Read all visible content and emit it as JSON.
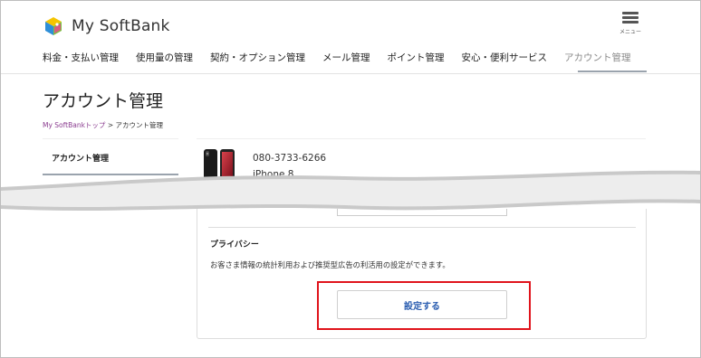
{
  "header": {
    "brand": "My SoftBank",
    "menu_label": "メニュー"
  },
  "nav": {
    "items": [
      {
        "label": "料金・支払い管理"
      },
      {
        "label": "使用量の管理"
      },
      {
        "label": "契約・オプション管理"
      },
      {
        "label": "メール管理"
      },
      {
        "label": "ポイント管理"
      },
      {
        "label": "安心・便利サービス"
      },
      {
        "label": "アカウント管理",
        "active": true
      }
    ]
  },
  "page": {
    "title": "アカウント管理",
    "breadcrumb": {
      "link": "My SoftBankトップ",
      "separator": " > ",
      "current": "アカウント管理"
    }
  },
  "sidebar": {
    "items": [
      {
        "label": "アカウント管理",
        "active": true
      }
    ]
  },
  "device": {
    "phone_number": "080-3733-6266",
    "model": "iPhone 8"
  },
  "privacy": {
    "title": "プライバシー",
    "description": "お客さま情報の統計利用および推奨型広告の利活用の設定ができます。",
    "button_label": "設定する"
  },
  "colors": {
    "highlight": "#e0131b",
    "link": "#8a3b8f",
    "button_text": "#2a5db0",
    "active_underline": "#9aa3ad"
  }
}
